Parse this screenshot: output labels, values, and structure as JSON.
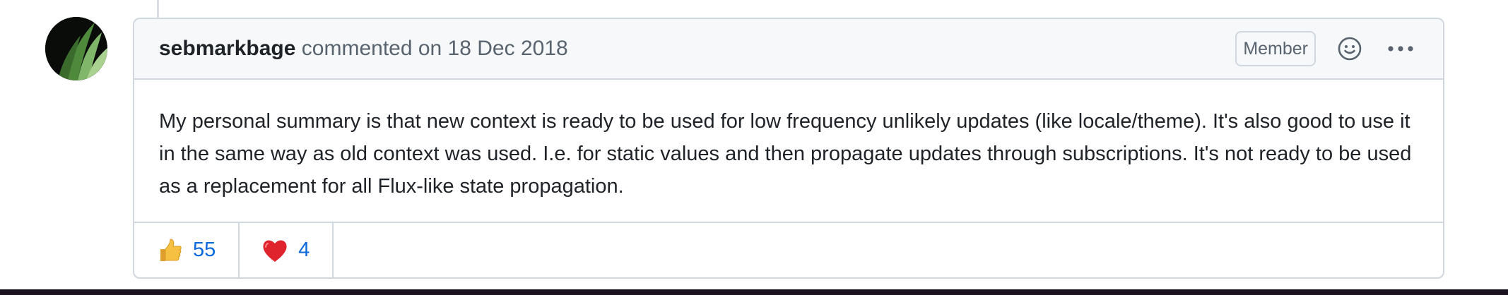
{
  "comment": {
    "author": "sebmarkbage",
    "action": "commented on 18 Dec 2018",
    "role_badge": "Member",
    "body": "My personal summary is that new context is ready to be used for low frequency unlikely updates (like locale/theme). It's also good to use it in the same way as old context was used. I.e. for static values and then propagate updates through subscriptions. It's not ready to be used as a replacement for all Flux-like state propagation.",
    "reactions": [
      {
        "emoji": "thumbs-up",
        "count": "55"
      },
      {
        "emoji": "red-heart",
        "count": "4"
      }
    ]
  },
  "icons": {
    "add_reaction": "smiley-icon",
    "more_options": "kebab-horizontal-icon"
  },
  "colors": {
    "link_blue": "#0969da",
    "border": "#d0d7de",
    "header_bg": "#f6f8fa",
    "muted_text": "#59636e"
  }
}
